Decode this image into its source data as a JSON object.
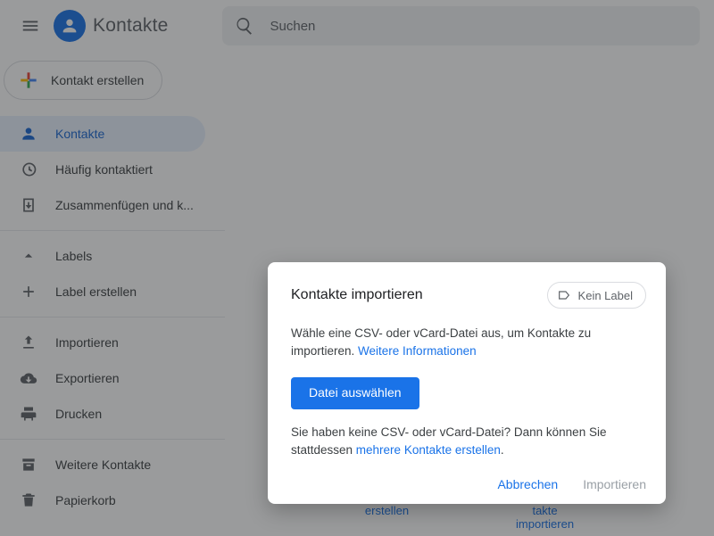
{
  "header": {
    "app_title": "Kontakte",
    "search_placeholder": "Suchen"
  },
  "sidebar": {
    "create_label": "Kontakt erstellen",
    "items": [
      {
        "label": "Kontakte"
      },
      {
        "label": "Häufig kontaktiert"
      },
      {
        "label": "Zusammenfügen und k..."
      }
    ],
    "labels_header": "Labels",
    "create_label_item": "Label erstellen",
    "io": [
      {
        "label": "Importieren"
      },
      {
        "label": "Exportieren"
      },
      {
        "label": "Drucken"
      }
    ],
    "other": [
      {
        "label": "Weitere Kontakte"
      },
      {
        "label": "Papierkorb"
      }
    ]
  },
  "main_actions": {
    "create": "erstellen",
    "import_line1": "takte",
    "import_line2": "importieren"
  },
  "dialog": {
    "title": "Kontakte importieren",
    "no_label_chip": "Kein Label",
    "instruction_prefix": "Wähle eine CSV- oder vCard-Datei aus, um Kontakte zu importieren. ",
    "more_info_link": "Weitere Informationen",
    "select_file_button": "Datei auswählen",
    "no_file_prefix": "Sie haben keine CSV- oder vCard-Datei? Dann können Sie stattdessen ",
    "create_many_link": "mehrere Kontakte erstellen",
    "period": ".",
    "cancel": "Abbrechen",
    "confirm": "Importieren"
  }
}
